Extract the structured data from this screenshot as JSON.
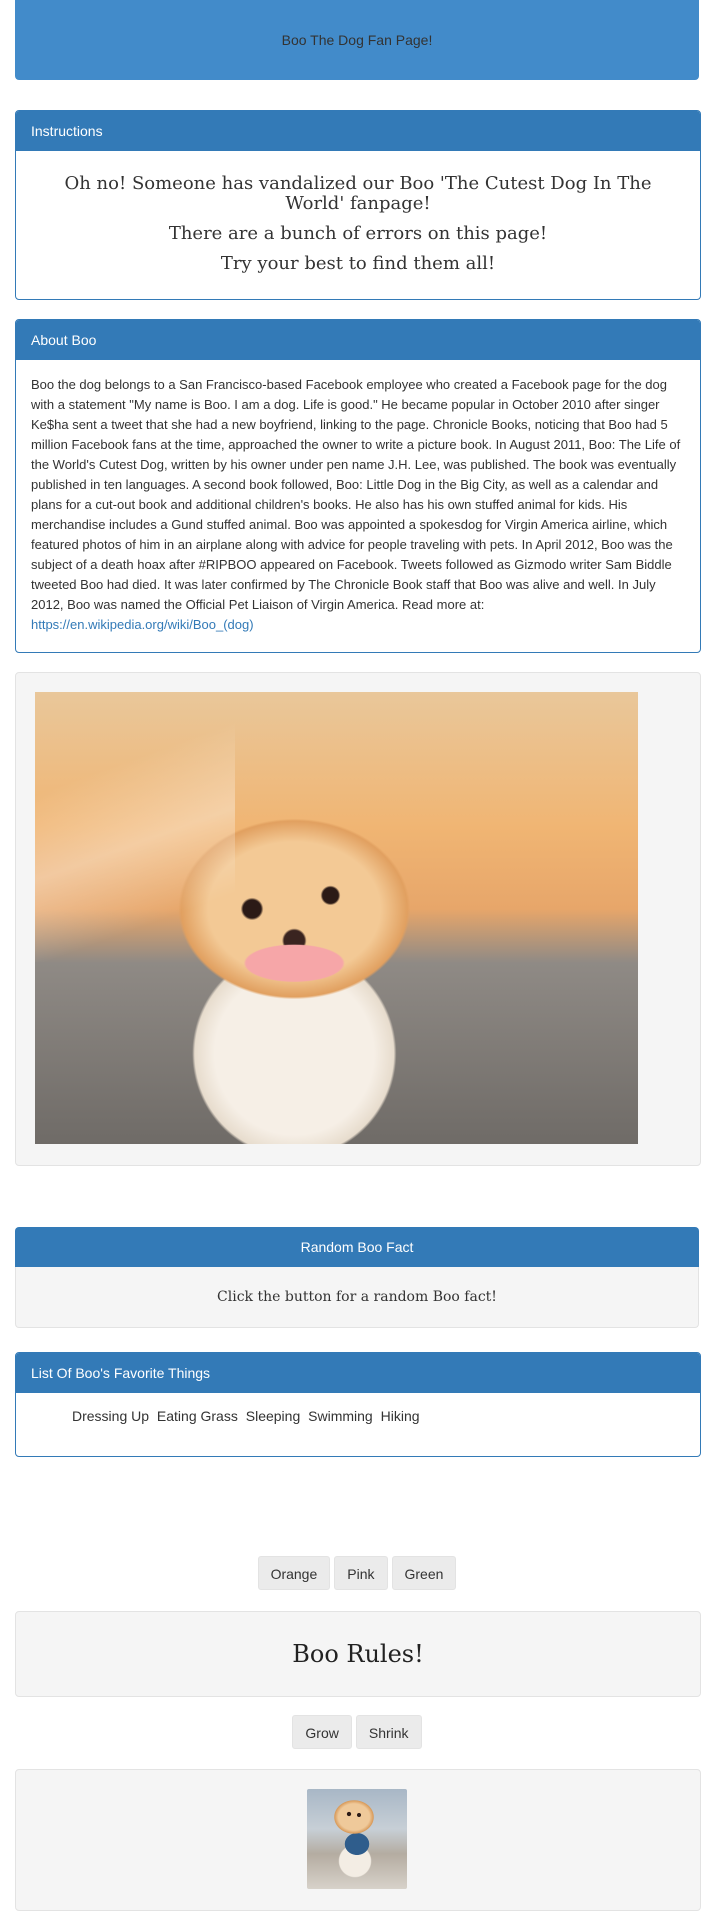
{
  "header": {
    "title": "Boo The Dog Fan Page!"
  },
  "instructions": {
    "heading": "Instructions",
    "line1": "Oh no! Someone has vandalized our Boo 'The Cutest Dog In The World' fanpage!",
    "line2": "There are a bunch of errors on this page!",
    "line3": "Try your best to find them all!"
  },
  "about": {
    "heading": "About Boo",
    "text": "Boo the dog belongs to a San Francisco-based Facebook employee who created a Facebook page for the dog with a statement \"My name is Boo. I am a dog. Life is good.\" He became popular in October 2010 after singer Ke$ha sent a tweet that she had a new boyfriend, linking to the page. Chronicle Books, noticing that Boo had 5 million Facebook fans at the time, approached the owner to write a picture book. In August 2011, Boo: The Life of the World's Cutest Dog, written by his owner under pen name J.H. Lee, was published. The book was eventually published in ten languages. A second book followed, Boo: Little Dog in the Big City, as well as a calendar and plans for a cut-out book and additional children's books. He also has his own stuffed animal for kids. His merchandise includes a Gund stuffed animal. Boo was appointed a spokesdog for Virgin America airline, which featured photos of him in an airplane along with advice for people traveling with pets. In April 2012, Boo was the subject of a death hoax after #RIPBOO appeared on Facebook. Tweets followed as Gizmodo writer Sam Biddle tweeted Boo had died. It was later confirmed by The Chronicle Book staff that Boo was alive and well. In July 2012, Boo was named the Official Pet Liaison of Virgin America. Read more at: ",
    "link": "https://en.wikipedia.org/wiki/Boo_(dog)"
  },
  "fact": {
    "heading": "Random Boo Fact",
    "text": "Click the button for a random Boo fact!"
  },
  "favorites": {
    "heading": "List Of Boo's Favorite Things",
    "items": [
      "Dressing Up",
      "Eating Grass",
      "Sleeping",
      "Swimming",
      "Hiking"
    ]
  },
  "color_buttons": {
    "orange": "Orange",
    "pink": "Pink",
    "green": "Green"
  },
  "rules_text": "Boo Rules!",
  "size_buttons": {
    "grow": "Grow",
    "shrink": "Shrink"
  },
  "colors": {
    "primary": "#337ab7",
    "hero": "#428bca",
    "well": "#f5f5f5"
  }
}
